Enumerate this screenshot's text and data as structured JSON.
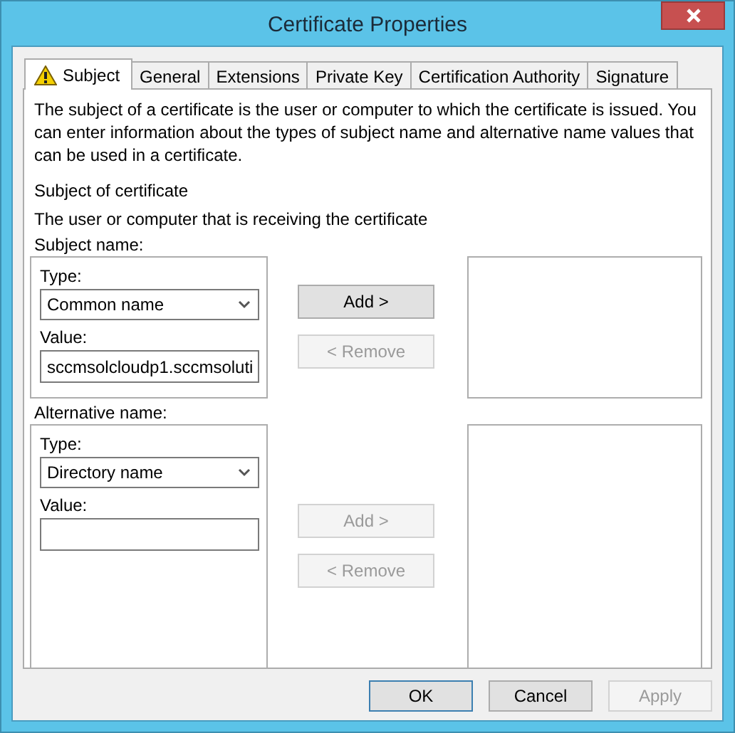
{
  "window": {
    "title": "Certificate Properties"
  },
  "tabs": [
    {
      "label": "Subject",
      "selected": true,
      "warning": true
    },
    {
      "label": "General",
      "selected": false,
      "warning": false
    },
    {
      "label": "Extensions",
      "selected": false,
      "warning": false
    },
    {
      "label": "Private Key",
      "selected": false,
      "warning": false
    },
    {
      "label": "Certification Authority",
      "selected": false,
      "warning": false
    },
    {
      "label": "Signature",
      "selected": false,
      "warning": false
    }
  ],
  "description": "The subject of a certificate is the user or computer to which the certificate is issued. You can enter information about the types of subject name and alternative name values that can be used in a certificate.",
  "section": {
    "title": "Subject of certificate",
    "subtitle": "The user or computer that is receiving the certificate"
  },
  "groups": [
    {
      "title": "Subject name:",
      "type_field": {
        "label": "Type:",
        "value": "Common name"
      },
      "value_field": {
        "label": "Value:",
        "value": "sccmsolcloudp1.sccmsoluti"
      },
      "buttons": [
        {
          "label": "Add >",
          "disabled": false
        },
        {
          "label": "< Remove",
          "disabled": true
        }
      ]
    },
    {
      "title": "Alternative name:",
      "type_field": {
        "label": "Type:",
        "value": "Directory name"
      },
      "value_field": {
        "label": "Value:"
      },
      "buttons": [
        {
          "label": "Add >",
          "disabled": true
        },
        {
          "label": "< Remove",
          "disabled": true
        }
      ]
    }
  ],
  "buttons": [
    {
      "label": "OK",
      "disabled": false,
      "default": true
    },
    {
      "label": "Cancel",
      "disabled": false,
      "default": false
    },
    {
      "label": "Apply",
      "disabled": true,
      "default": false
    }
  ]
}
